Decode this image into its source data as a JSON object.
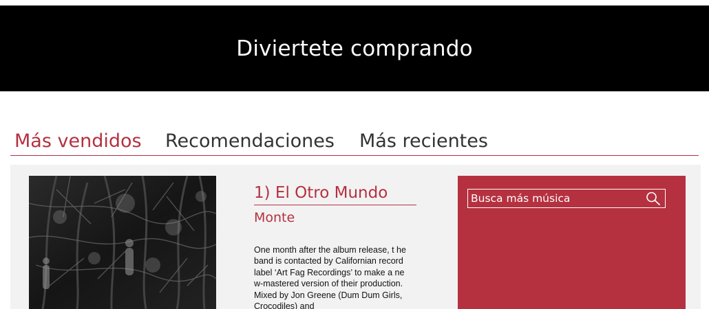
{
  "header": {
    "title": "Diviertete comprando"
  },
  "tabs": [
    {
      "label": "Más vendidos",
      "active": true
    },
    {
      "label": "Recomendaciones",
      "active": false
    },
    {
      "label": "Más recientes",
      "active": false
    }
  ],
  "product": {
    "title": "1) El Otro Mundo",
    "artist": "Monte",
    "description": "One month after the album release, t he band is contacted by Californian record label ‘Art Fag Recordings’ to make a new-mastered version of their production. Mixed by Jon Greene (Dum Dum Girls, Crocodiles) and"
  },
  "search": {
    "placeholder": "Busca más música",
    "icon": "search-icon"
  },
  "colors": {
    "accent": "#b5303f",
    "banner": "#000000",
    "panel": "#f2f2f2"
  }
}
